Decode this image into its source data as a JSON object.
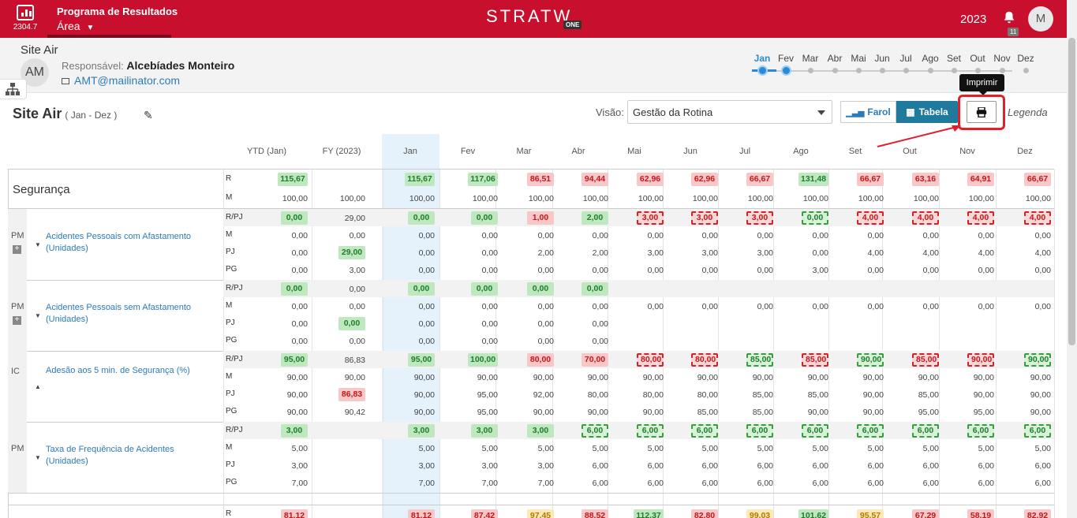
{
  "topbar": {
    "version": "2304.7",
    "program": "Programa de Resultados",
    "area": "Área",
    "brand": "STRATW",
    "brand_sub": "ONE",
    "year": "2023",
    "notif_count": "11",
    "user_initial": "M"
  },
  "subheader": {
    "unit": "Site Air",
    "avatar": "AM",
    "resp_label": "Responsável:",
    "resp_name": "Alcebíades Monteiro",
    "email": "AMT@mailinator.com"
  },
  "timeline": {
    "months": [
      "Jan",
      "Fev",
      "Mar",
      "Abr",
      "Mai",
      "Jun",
      "Jul",
      "Ago",
      "Set",
      "Out",
      "Nov",
      "Dez"
    ],
    "active": "Jan"
  },
  "toolbar": {
    "title": "Site Air",
    "period": "( Jan - Dez )",
    "visao_label": "Visão:",
    "visao_value": "Gestão da Rotina",
    "farol": "Farol",
    "tabela": "Tabela",
    "print_tooltip": "Imprimir",
    "legenda": "Legenda"
  },
  "columns": [
    "YTD (Jan)",
    "FY (2023)",
    "Jan",
    "Fev",
    "Mar",
    "Abr",
    "Mai",
    "Jun",
    "Jul",
    "Ago",
    "Set",
    "Out",
    "Nov",
    "Dez"
  ],
  "section": {
    "title": "Segurança",
    "R": [
      "115,67",
      "",
      "115,67",
      "117,06",
      "86,51",
      "94,44",
      "62,96",
      "62,96",
      "66,67",
      "131,48",
      "66,67",
      "63,16",
      "64,91",
      "66,67"
    ],
    "R_style": [
      "g",
      "",
      "g",
      "g",
      "r",
      "r",
      "r",
      "r",
      "r",
      "g",
      "r",
      "r",
      "r",
      "r"
    ],
    "M": [
      "100,00",
      "100,00",
      "100,00",
      "100,00",
      "100,00",
      "100,00",
      "100,00",
      "100,00",
      "100,00",
      "100,00",
      "100,00",
      "100,00",
      "100,00",
      "100,00"
    ]
  },
  "indicators": [
    {
      "type": "PM",
      "name": "Acidentes Pessoais com Afastamento (Unidades)",
      "rows": [
        {
          "label": "R/PJ",
          "values": [
            "0,00",
            "29,00",
            "0,00",
            "0,00",
            "1,00",
            "2,00",
            "3,00",
            "3,00",
            "3,00",
            "0,00",
            "4,00",
            "4,00",
            "4,00",
            "4,00"
          ],
          "styles": [
            "g",
            "",
            "g",
            "g",
            "r",
            "g",
            "rd",
            "rd",
            "rd",
            "gd",
            "rd",
            "rd",
            "rd",
            "rd"
          ]
        },
        {
          "label": "M",
          "values": [
            "0,00",
            "0,00",
            "0,00",
            "0,00",
            "0,00",
            "0,00",
            "0,00",
            "0,00",
            "0,00",
            "0,00",
            "0,00",
            "0,00",
            "0,00",
            "0,00"
          ],
          "styles": []
        },
        {
          "label": "PJ",
          "values": [
            "0,00",
            "29,00",
            "0,00",
            "0,00",
            "2,00",
            "2,00",
            "3,00",
            "3,00",
            "3,00",
            "0,00",
            "4,00",
            "4,00",
            "4,00",
            "4,00"
          ],
          "styles": [
            "",
            "g"
          ]
        },
        {
          "label": "PG",
          "values": [
            "0,00",
            "3,00",
            "0,00",
            "0,00",
            "0,00",
            "0,00",
            "0,00",
            "0,00",
            "0,00",
            "3,00",
            "0,00",
            "0,00",
            "0,00",
            "0,00"
          ],
          "styles": []
        }
      ]
    },
    {
      "type": "PM",
      "name": "Acidentes Pessoais sem Afastamento (Unidades)",
      "rows": [
        {
          "label": "R/PJ",
          "values": [
            "0,00",
            "0,00",
            "0,00",
            "0,00",
            "0,00",
            "0,00",
            "",
            "",
            "",
            "",
            "",
            "",
            "",
            ""
          ],
          "styles": [
            "g",
            "",
            "g",
            "g",
            "g",
            "g"
          ]
        },
        {
          "label": "M",
          "values": [
            "0,00",
            "0,00",
            "0,00",
            "0,00",
            "0,00",
            "0,00",
            "0,00",
            "0,00",
            "0,00",
            "0,00",
            "0,00",
            "0,00",
            "0,00",
            "0,00"
          ],
          "styles": []
        },
        {
          "label": "PJ",
          "values": [
            "0,00",
            "0,00",
            "0,00",
            "0,00",
            "0,00",
            "0,00",
            "",
            "",
            "",
            "",
            "",
            "",
            "",
            ""
          ],
          "styles": [
            "",
            "g"
          ]
        },
        {
          "label": "PG",
          "values": [
            "0,00",
            "0,00",
            "0,00",
            "0,00",
            "0,00",
            "0,00",
            "",
            "",
            "",
            "",
            "",
            "",
            "",
            ""
          ],
          "styles": []
        }
      ]
    },
    {
      "type": "IC",
      "name": "Adesão aos 5 min. de Segurança (%)",
      "rows": [
        {
          "label": "R/PJ",
          "values": [
            "95,00",
            "86,83",
            "95,00",
            "100,00",
            "80,00",
            "70,00",
            "80,00",
            "80,00",
            "85,00",
            "85,00",
            "90,00",
            "85,00",
            "90,00",
            "90,00"
          ],
          "styles": [
            "g",
            "",
            "g",
            "g",
            "r",
            "r",
            "rd",
            "rd",
            "gd",
            "rd",
            "gd",
            "rd",
            "rd",
            "gd"
          ]
        },
        {
          "label": "M",
          "values": [
            "90,00",
            "90,00",
            "90,00",
            "90,00",
            "90,00",
            "90,00",
            "90,00",
            "90,00",
            "90,00",
            "90,00",
            "90,00",
            "90,00",
            "90,00",
            "90,00"
          ],
          "styles": []
        },
        {
          "label": "PJ",
          "values": [
            "90,00",
            "86,83",
            "90,00",
            "95,00",
            "92,00",
            "80,00",
            "80,00",
            "80,00",
            "85,00",
            "85,00",
            "90,00",
            "85,00",
            "90,00",
            "90,00"
          ],
          "styles": [
            "",
            "r"
          ]
        },
        {
          "label": "PG",
          "values": [
            "90,00",
            "90,42",
            "90,00",
            "95,00",
            "90,00",
            "90,00",
            "90,00",
            "85,00",
            "85,00",
            "90,00",
            "90,00",
            "95,00",
            "95,00",
            "90,00"
          ],
          "styles": []
        }
      ]
    },
    {
      "type": "PM",
      "name": "Taxa de Frequência de Acidentes (Unidades)",
      "rows": [
        {
          "label": "R/PJ",
          "values": [
            "3,00",
            "",
            "3,00",
            "3,00",
            "3,00",
            "6,00",
            "6,00",
            "6,00",
            "6,00",
            "6,00",
            "6,00",
            "6,00",
            "6,00",
            "6,00"
          ],
          "styles": [
            "g",
            "",
            "g",
            "g",
            "g",
            "gd",
            "gd",
            "gd",
            "gd",
            "gd",
            "gd",
            "gd",
            "gd",
            "gd"
          ]
        },
        {
          "label": "M",
          "values": [
            "5,00",
            "",
            "5,00",
            "5,00",
            "5,00",
            "5,00",
            "5,00",
            "5,00",
            "5,00",
            "5,00",
            "5,00",
            "5,00",
            "5,00",
            "5,00"
          ],
          "styles": []
        },
        {
          "label": "PJ",
          "values": [
            "3,00",
            "",
            "3,00",
            "3,00",
            "3,00",
            "6,00",
            "6,00",
            "6,00",
            "6,00",
            "6,00",
            "6,00",
            "6,00",
            "6,00",
            "6,00"
          ],
          "styles": []
        },
        {
          "label": "PG",
          "values": [
            "7,00",
            "",
            "7,00",
            "7,00",
            "7,00",
            "6,00",
            "6,00",
            "6,00",
            "6,00",
            "6,00",
            "6,00",
            "6,00",
            "6,00",
            "6,00"
          ],
          "styles": []
        }
      ]
    }
  ],
  "next_section": {
    "label": "R",
    "values": [
      "81,12",
      "",
      "81,12",
      "87,42",
      "97,45",
      "88,52",
      "112,37",
      "82,80",
      "99,03",
      "101,62",
      "95,57",
      "67,29",
      "58,19",
      "82,92"
    ],
    "styles": [
      "r",
      "",
      "r",
      "r",
      "y",
      "r",
      "g",
      "r",
      "y",
      "g",
      "y",
      "r",
      "r",
      "r"
    ]
  }
}
